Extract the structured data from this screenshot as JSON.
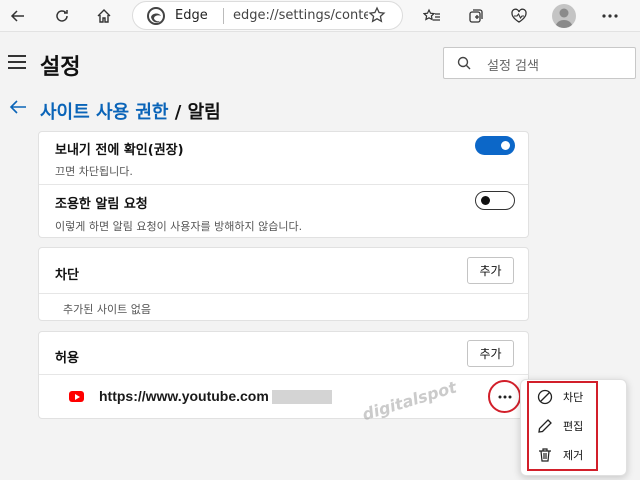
{
  "browser": {
    "address_label": "Edge",
    "url": "edge://settings/content"
  },
  "header": {
    "title": "설정",
    "search_placeholder": "설정 검색"
  },
  "breadcrumb": {
    "parent": "사이트 사용 권한",
    "separator": "/",
    "current": "알림"
  },
  "notifications": {
    "confirm": {
      "title": "보내기 전에 확인(권장)",
      "desc": "끄면 차단됩니다.",
      "enabled": true
    },
    "quiet": {
      "title": "조용한 알림 요청",
      "desc": "이렇게 하면 알림 요청이 사용자를 방해하지 않습니다.",
      "enabled": false
    }
  },
  "block": {
    "title": "차단",
    "add_label": "추가",
    "empty_text": "추가된 사이트 없음"
  },
  "allow": {
    "title": "허용",
    "add_label": "추가",
    "sites": [
      {
        "url": "https://www.youtube.com"
      }
    ]
  },
  "watermark": "digitalspot",
  "context_menu": {
    "items": [
      {
        "label": "차단",
        "icon": "block-icon"
      },
      {
        "label": "편집",
        "icon": "pencil-icon"
      },
      {
        "label": "제거",
        "icon": "trash-icon"
      }
    ]
  },
  "colors": {
    "accent": "#0c67c8",
    "link": "#0a64b8",
    "highlight": "#d21f2a",
    "youtube": "#ff0000"
  }
}
